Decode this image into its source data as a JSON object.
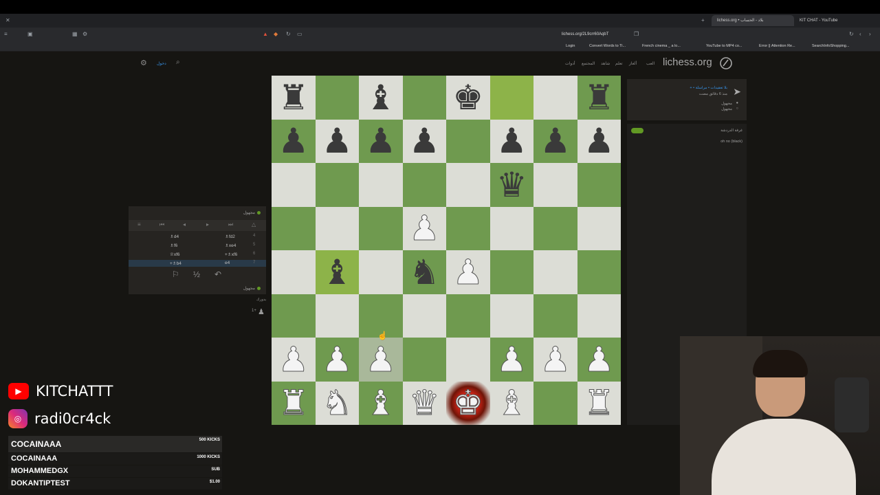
{
  "browser": {
    "tabs": [
      {
        "label": "lichess.org • بلاد - الحساب"
      },
      {
        "label": "KIT CHAT - YouTube"
      }
    ],
    "url": "lichess.org/2L9crr60AqbT",
    "bookmarks": [
      {
        "label": "Login"
      },
      {
        "label": "Convert Words to Ti..."
      },
      {
        "label": "French cinema _ a lo..."
      },
      {
        "label": "YouTube to MP4 co..."
      },
      {
        "label": "Error || Attention Re..."
      },
      {
        "label": "SearchInfoShopping..."
      }
    ]
  },
  "lichess": {
    "logo": "lichess.org",
    "nav": [
      "العب",
      "ألغاز",
      "تعلم",
      "شاهد",
      "المجتمع",
      "أدوات"
    ],
    "signin": "دخول"
  },
  "board": {
    "rows": [
      [
        {
          "p": "♜",
          "c": "black"
        },
        {
          "p": "",
          "c": ""
        },
        {
          "p": "♝",
          "c": "black"
        },
        {
          "p": "",
          "c": ""
        },
        {
          "p": "♚",
          "c": "black"
        },
        {
          "p": "",
          "c": "",
          "hl": true
        },
        {
          "p": "",
          "c": ""
        },
        {
          "p": "♜",
          "c": "black"
        }
      ],
      [
        {
          "p": "♟",
          "c": "black"
        },
        {
          "p": "♟",
          "c": "black"
        },
        {
          "p": "♟",
          "c": "black"
        },
        {
          "p": "♟",
          "c": "black"
        },
        {
          "p": "",
          "c": ""
        },
        {
          "p": "♟",
          "c": "black"
        },
        {
          "p": "♟",
          "c": "black"
        },
        {
          "p": "♟",
          "c": "black"
        }
      ],
      [
        {
          "p": "",
          "c": ""
        },
        {
          "p": "",
          "c": ""
        },
        {
          "p": "",
          "c": ""
        },
        {
          "p": "",
          "c": ""
        },
        {
          "p": "",
          "c": ""
        },
        {
          "p": "♛",
          "c": "black"
        },
        {
          "p": "",
          "c": ""
        },
        {
          "p": "",
          "c": ""
        }
      ],
      [
        {
          "p": "",
          "c": ""
        },
        {
          "p": "",
          "c": ""
        },
        {
          "p": "",
          "c": ""
        },
        {
          "p": "♟",
          "c": "white"
        },
        {
          "p": "",
          "c": ""
        },
        {
          "p": "",
          "c": ""
        },
        {
          "p": "",
          "c": ""
        },
        {
          "p": "",
          "c": ""
        }
      ],
      [
        {
          "p": "",
          "c": ""
        },
        {
          "p": "♝",
          "c": "black",
          "hl": true
        },
        {
          "p": "",
          "c": ""
        },
        {
          "p": "♞",
          "c": "black"
        },
        {
          "p": "♟",
          "c": "white"
        },
        {
          "p": "",
          "c": ""
        },
        {
          "p": "",
          "c": ""
        },
        {
          "p": "",
          "c": ""
        }
      ],
      [
        {
          "p": "",
          "c": ""
        },
        {
          "p": "",
          "c": ""
        },
        {
          "p": "",
          "c": ""
        },
        {
          "p": "",
          "c": ""
        },
        {
          "p": "",
          "c": ""
        },
        {
          "p": "",
          "c": ""
        },
        {
          "p": "",
          "c": ""
        },
        {
          "p": "",
          "c": ""
        }
      ],
      [
        {
          "p": "♟",
          "c": "white"
        },
        {
          "p": "♟",
          "c": "white"
        },
        {
          "p": "♟",
          "c": "white",
          "fade": true
        },
        {
          "p": "",
          "c": ""
        },
        {
          "p": "",
          "c": ""
        },
        {
          "p": "♟",
          "c": "white"
        },
        {
          "p": "♟",
          "c": "white"
        },
        {
          "p": "♟",
          "c": "white"
        }
      ],
      [
        {
          "p": "♜",
          "c": "white"
        },
        {
          "p": "♞",
          "c": "white"
        },
        {
          "p": "♝",
          "c": "white"
        },
        {
          "p": "♛",
          "c": "white"
        },
        {
          "p": "♚",
          "c": "white",
          "check": true
        },
        {
          "p": "♝",
          "c": "white"
        },
        {
          "p": "",
          "c": ""
        },
        {
          "p": "♜",
          "c": "white"
        }
      ]
    ]
  },
  "movelist": {
    "top_player": "مجهول",
    "bottom_player": "مجهول",
    "moves": [
      {
        "num": "4",
        "white": "♗fd2",
        "black": "♗d4"
      },
      {
        "num": "5",
        "white": "♗xe4",
        "black": "♗f6"
      },
      {
        "num": "6",
        "white": "+♗xf6",
        "black": "♕xf6"
      },
      {
        "num": "7",
        "white": "e4",
        "black": "+♗b4"
      }
    ],
    "under_label": "بدورك",
    "under_clock": "1+"
  },
  "right": {
    "invite_line1": "+ • بلا تعقيدات • مراسلة",
    "invite_line2": "منذ 6 دقائق مضت",
    "player1": "مجهول",
    "player2": "مجهول",
    "chat_title": "غرفة الدردشة",
    "chat_msg": "oh no (black)"
  },
  "overlay": {
    "youtube": "KITCHATTT",
    "instagram": "radi0cr4ck",
    "kicks": [
      {
        "name": "COCAINAAA",
        "amount": "500 KICKS"
      },
      {
        "name": "COCAINAAA",
        "amount": "1000 KICKS"
      },
      {
        "name": "MOHAMMEDGX",
        "amount": "SUB"
      },
      {
        "name": "DOKANTIPTEST",
        "amount": "$1.00"
      }
    ]
  },
  "colors": {
    "board_light": "#dcddd6",
    "board_dark": "#6f9a4f",
    "highlight": "#a8c66a",
    "youtube_red": "#ff0000"
  }
}
